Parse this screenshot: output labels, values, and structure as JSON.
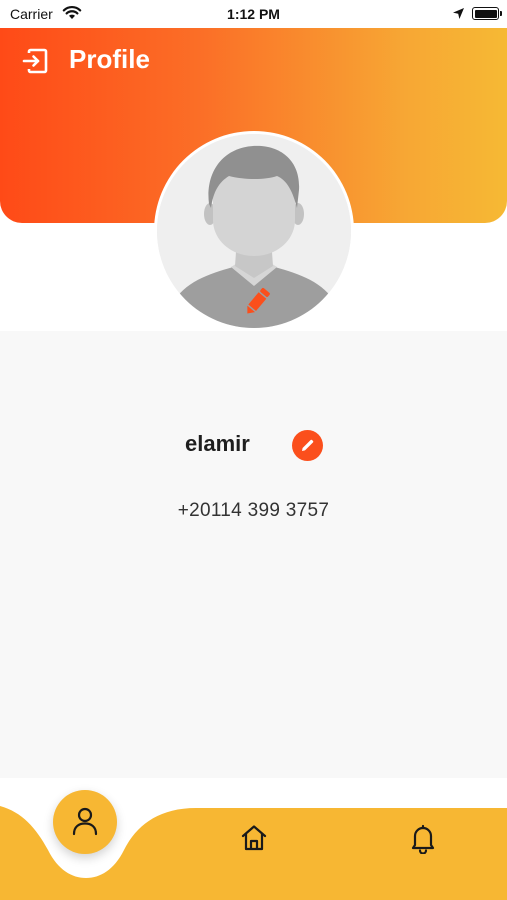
{
  "status_bar": {
    "carrier": "Carrier",
    "time": "1:12 PM"
  },
  "header": {
    "title": "Profile",
    "logout_icon": "logout-icon"
  },
  "profile": {
    "avatar_icon": "default-user-avatar",
    "name": "elamir",
    "phone": "+20114 399 3757"
  },
  "bottom_nav": {
    "items": [
      {
        "id": "profile",
        "icon": "user-icon",
        "active": true
      },
      {
        "id": "home",
        "icon": "home-icon",
        "active": false
      },
      {
        "id": "notifications",
        "icon": "bell-icon",
        "active": false
      }
    ]
  },
  "colors": {
    "gradient_start": "#ff4a17",
    "gradient_end": "#f6b934",
    "accent": "#fb4f1c",
    "nav_bar": "#f7b733",
    "content_bg": "#f8f8f8"
  }
}
